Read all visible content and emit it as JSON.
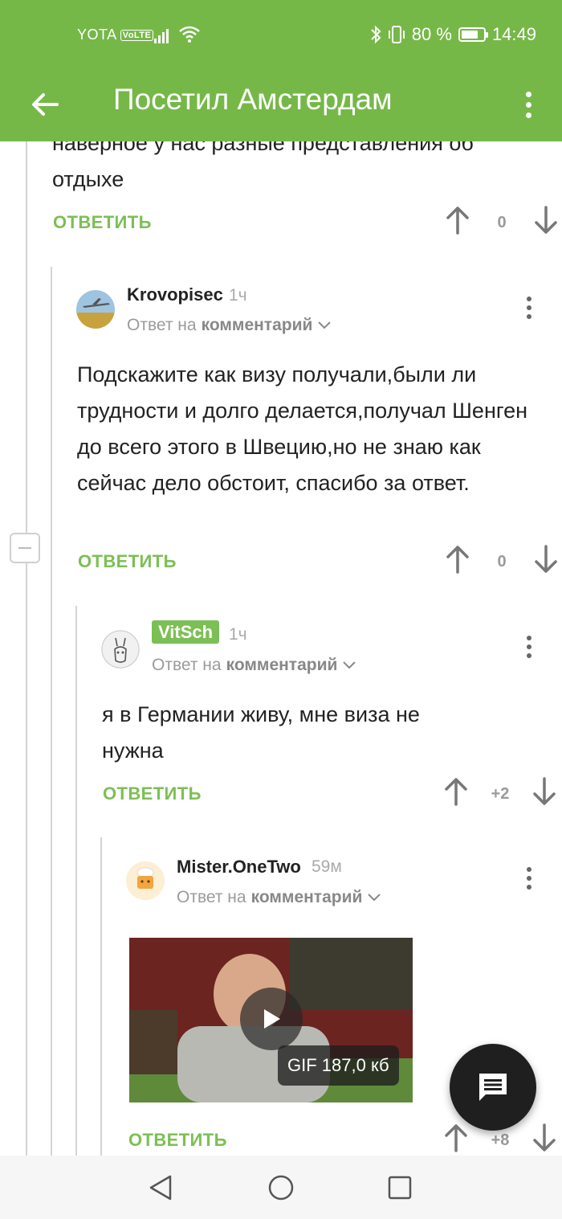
{
  "status_bar": {
    "carrier": "YOTA",
    "volte": "VoLTE",
    "battery": "80 %",
    "battery_level": 0.8,
    "time": "14:49"
  },
  "app_bar": {
    "title": "Посетил Амстердам"
  },
  "prev_comment": {
    "text": "наверное у нас разные представления об отдыхе",
    "reply_label": "ОТВЕТИТЬ",
    "score": "0"
  },
  "comments": [
    {
      "author": "Krovopisec",
      "time": "1ч",
      "reply_to_prefix": "Ответ на",
      "reply_to_target": "комментарий",
      "text": "Подскажите как визу получали,были ли трудности и долго делается,получал Шенген до всего этого в Швецию,но не знаю как сейчас дело обстоит, спасибо за ответ.",
      "reply_label": "ОТВЕТИТЬ",
      "score": "0"
    },
    {
      "author": "VitSch",
      "time": "1ч",
      "reply_to_prefix": "Ответ на",
      "reply_to_target": "комментарий",
      "text": "я в Германии живу, мне виза не нужна",
      "reply_label": "ОТВЕТИТЬ",
      "score": "+2"
    },
    {
      "author": "Mister.OneTwo",
      "time": "59м",
      "reply_to_prefix": "Ответ на",
      "reply_to_target": "комментарий",
      "gif_label": "GIF 187,0 кб",
      "reply_label": "ОТВЕТИТЬ",
      "score": "+8"
    }
  ],
  "colors": {
    "brand_green": "#76b848",
    "reply_green": "#7cbf55",
    "fab_dark": "#1f1f1f"
  },
  "icons": {
    "back": "arrow-left-icon",
    "more": "more-vertical-icon",
    "upvote": "arrow-up-icon",
    "downvote": "arrow-down-icon",
    "collapse": "minus-icon",
    "play": "play-icon",
    "fab": "comment-icon",
    "nav_back": "triangle-back-icon",
    "nav_home": "circle-home-icon",
    "nav_recents": "square-recents-icon"
  }
}
